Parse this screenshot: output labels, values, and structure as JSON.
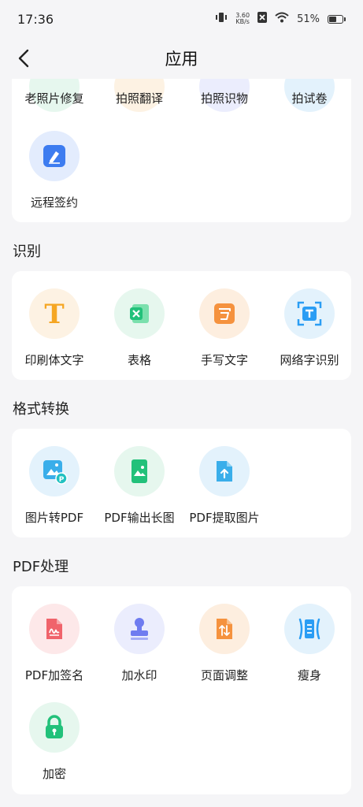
{
  "status_bar": {
    "time": "17:36",
    "net_speed_value": "3.60",
    "net_speed_unit": "KB/s",
    "battery": "51%"
  },
  "header": {
    "title": "应用"
  },
  "top_section": {
    "items": [
      {
        "label": "老照片修复"
      },
      {
        "label": "拍照翻译"
      },
      {
        "label": "拍照识物"
      },
      {
        "label": "拍试卷"
      },
      {
        "label": "远程签约",
        "icon": "pen-sign-icon",
        "color": "#3d7cf0"
      }
    ]
  },
  "sections": [
    {
      "title": "识别",
      "items": [
        {
          "label": "印刷体文字",
          "icon": "letter-t-icon",
          "color": "#f5a623",
          "bg": "#fdf2e3"
        },
        {
          "label": "表格",
          "icon": "excel-x-icon",
          "color": "#22c17a",
          "bg": "#e6f7ee"
        },
        {
          "label": "手写文字",
          "icon": "handwrite-icon",
          "color": "#f5923e",
          "bg": "#fdeedf"
        },
        {
          "label": "网络字识别",
          "icon": "scan-text-icon",
          "color": "#2a9df4",
          "bg": "#e3f2fc"
        }
      ]
    },
    {
      "title": "格式转换",
      "items": [
        {
          "label": "图片转PDF",
          "icon": "image-to-pdf-icon",
          "color": "#3aaeea",
          "bg": "#e3f2fc"
        },
        {
          "label": "PDF输出长图",
          "icon": "long-image-icon",
          "color": "#22c17a",
          "bg": "#e6f7ee"
        },
        {
          "label": "PDF提取图片",
          "icon": "extract-upload-icon",
          "color": "#3aaeea",
          "bg": "#e3f2fc"
        }
      ]
    },
    {
      "title": "PDF处理",
      "items": [
        {
          "label": "PDF加签名",
          "icon": "signature-doc-icon",
          "color": "#f0636b",
          "bg": "#fde8e9"
        },
        {
          "label": "加水印",
          "icon": "stamp-icon",
          "color": "#6f7cf0",
          "bg": "#ebedfd"
        },
        {
          "label": "页面调整",
          "icon": "page-adjust-icon",
          "color": "#f5923e",
          "bg": "#fdeedf"
        },
        {
          "label": "瘦身",
          "icon": "compress-icon",
          "color": "#2a9df4",
          "bg": "#e3f2fc"
        },
        {
          "label": "加密",
          "icon": "lock-icon",
          "color": "#22c17a",
          "bg": "#e6f7ee"
        }
      ]
    }
  ]
}
